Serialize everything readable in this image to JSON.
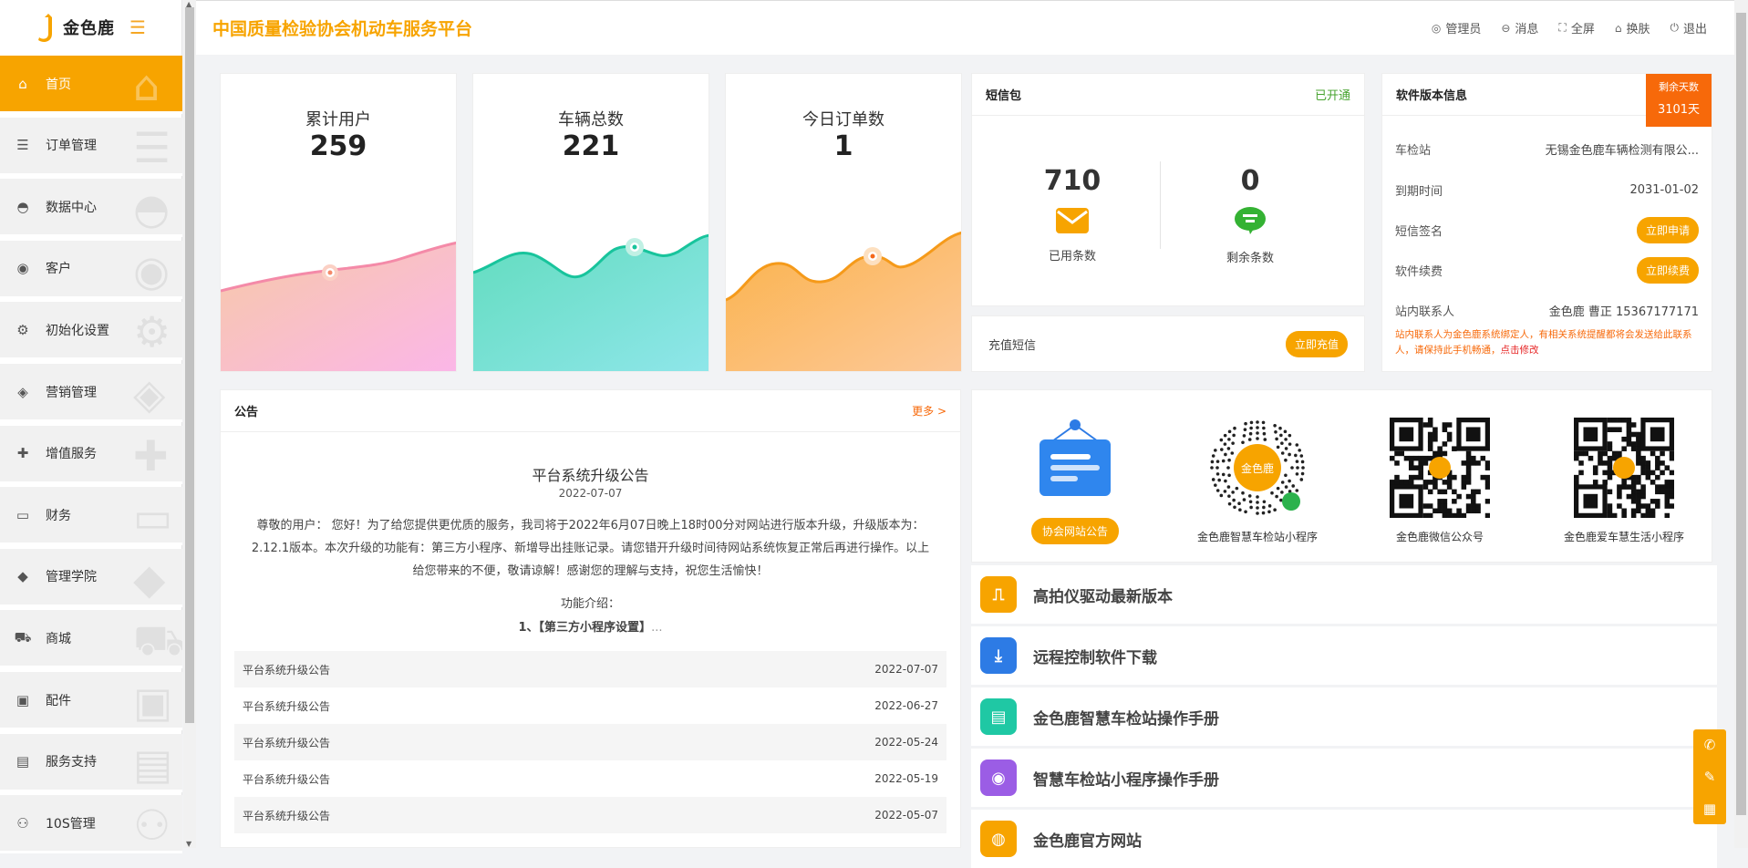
{
  "brand": {
    "name": "金色鹿"
  },
  "sidebar": {
    "items": [
      {
        "label": "首页",
        "icon": "home-icon"
      },
      {
        "label": "订单管理",
        "icon": "list-icon"
      },
      {
        "label": "数据中心",
        "icon": "chart-icon"
      },
      {
        "label": "客户",
        "icon": "user-icon"
      },
      {
        "label": "初始化设置",
        "icon": "gear-icon"
      },
      {
        "label": "营销管理",
        "icon": "tag-icon"
      },
      {
        "label": "增值服务",
        "icon": "add-user-icon"
      },
      {
        "label": "财务",
        "icon": "card-icon"
      },
      {
        "label": "管理学院",
        "icon": "graduation-icon"
      },
      {
        "label": "商城",
        "icon": "cart-icon"
      },
      {
        "label": "配件",
        "icon": "clipboard-icon"
      },
      {
        "label": "服务支持",
        "icon": "box-icon"
      },
      {
        "label": "10S管理",
        "icon": "group-icon"
      }
    ]
  },
  "header": {
    "title": "中国质量检验协会机动车服务平台",
    "tools": {
      "admin": "管理员",
      "message": "消息",
      "fullscreen": "全屏",
      "skin": "换肤",
      "logout": "退出"
    }
  },
  "stats": [
    {
      "title": "累计用户",
      "value": "259",
      "color": "#f472b6"
    },
    {
      "title": "车辆总数",
      "value": "221",
      "color": "#1fc8a4"
    },
    {
      "title": "今日订单数",
      "value": "1",
      "color": "#f7a400"
    }
  ],
  "sms": {
    "title": "短信包",
    "status": "已开通",
    "used": {
      "value": "710",
      "label": "已用条数"
    },
    "left": {
      "value": "0",
      "label": "剩余条数"
    },
    "recharge_label": "充值短信",
    "recharge_button": "立即充值"
  },
  "software": {
    "title": "软件版本信息",
    "ribbon_label": "剩余天数",
    "ribbon_value": "3101天",
    "rows": {
      "station": {
        "label": "车检站",
        "value": "无锡金色鹿车辆检测有限公..."
      },
      "expire": {
        "label": "到期时间",
        "value": "2031-01-02"
      },
      "sign": {
        "label": "短信签名",
        "button": "立即申请"
      },
      "renew": {
        "label": "软件续费",
        "button": "立即续费"
      },
      "contact": {
        "label": "站内联系人",
        "value": "金色鹿 曹正 15367177171"
      }
    },
    "note": "站内联系人为金色鹿系统绑定人，有相关系统提醒都将会发送给此联系人，请保持此手机畅通，",
    "note_link": "点击修改"
  },
  "notice": {
    "title": "公告",
    "more": "更多 >",
    "headline": "平台系统升级公告",
    "date": "2022-07-07",
    "body": "尊敬的用户： 您好！为了给您提供更优质的服务，我司将于2022年6月07日晚上18时00分对网站进行版本升级，升级版本为：2.12.1版本。本次升级的功能有：第三方小程序、新增导出挂账记录。请您错开升级时间待网站系统恢复正常后再进行操作。以上给您带来的不便，敬请谅解！感谢您的理解与支持，祝您生活愉快！",
    "feature_title": "功能介绍：",
    "feature_item": "1、【第三方小程序设置】",
    "feature_more": "...",
    "list": [
      {
        "title": "平台系统升级公告",
        "date": "2022-07-07"
      },
      {
        "title": "平台系统升级公告",
        "date": "2022-06-27"
      },
      {
        "title": "平台系统升级公告",
        "date": "2022-05-24"
      },
      {
        "title": "平台系统升级公告",
        "date": "2022-05-19"
      },
      {
        "title": "平台系统升级公告",
        "date": "2022-05-07"
      }
    ]
  },
  "qrs": [
    {
      "label": "协会网站公告"
    },
    {
      "label": "金色鹿智慧车检站小程序"
    },
    {
      "label": "金色鹿微信公众号"
    },
    {
      "label": "金色鹿爱车慧生活小程序"
    }
  ],
  "links": [
    {
      "label": "高拍仪驱动最新版本",
      "color": "#f7a400",
      "icon": "camera-icon"
    },
    {
      "label": "远程控制软件下载",
      "color": "#2d7be5",
      "icon": "download-icon"
    },
    {
      "label": "金色鹿智慧车检站操作手册",
      "color": "#1fc8a4",
      "icon": "book-icon"
    },
    {
      "label": "智慧车检站小程序操作手册",
      "color": "#9b5de5",
      "icon": "location-icon"
    },
    {
      "label": "金色鹿官方网站",
      "color": "#f7a400",
      "icon": "globe-icon"
    }
  ]
}
